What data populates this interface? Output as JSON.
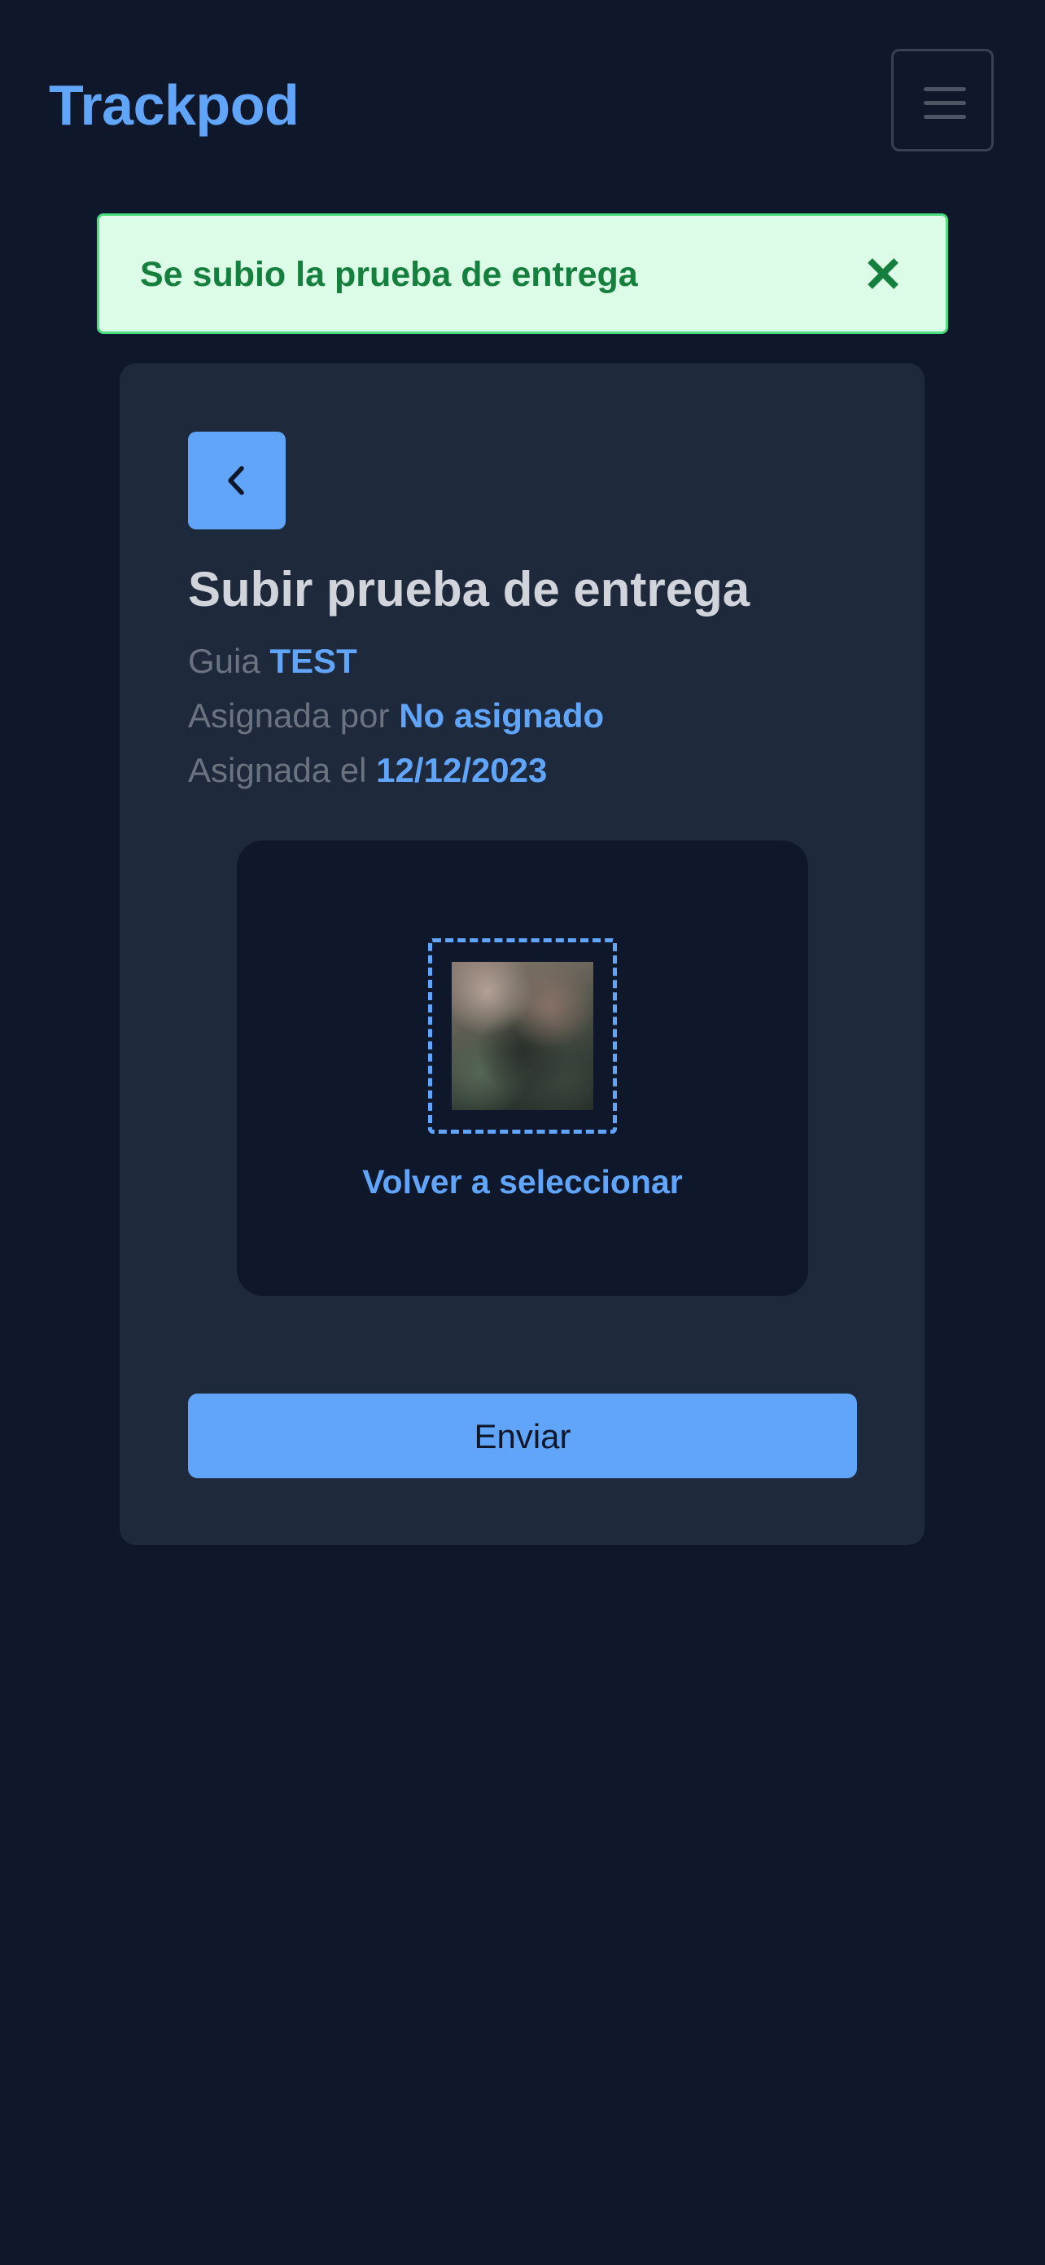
{
  "header": {
    "brand": "Trackpod",
    "menu_icon": "hamburger-menu-icon"
  },
  "alert": {
    "message": "Se subio la prueba de entrega",
    "close_icon": "close-icon",
    "text_color": "#15803d",
    "background": "#dcfce7"
  },
  "card": {
    "back_icon": "chevron-left-icon",
    "title": "Subir prueba de entrega",
    "guide_label": "Guia",
    "guide_value": "TEST",
    "assigned_by_label": "Asignada por",
    "assigned_by_value": "No asignado",
    "assigned_on_label": "Asignada el",
    "assigned_on_value": "12/12/2023",
    "upload": {
      "reselect_label": "Volver a seleccionar"
    },
    "submit_label": "Enviar"
  },
  "colors": {
    "page_background": "#0f172a",
    "card_background": "#1e293b",
    "accent": "#60a5fa",
    "muted_text": "#6b7280",
    "title_text": "#d1d5db"
  }
}
